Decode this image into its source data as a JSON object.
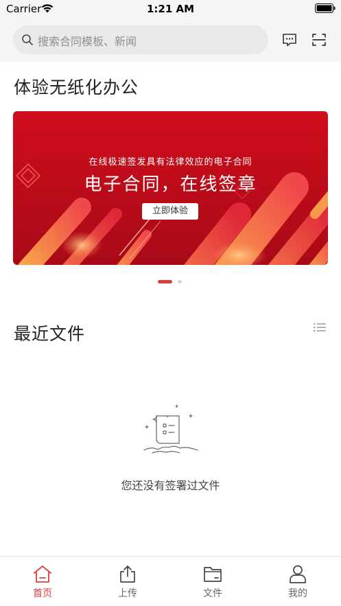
{
  "status_bar": {
    "carrier": "Carrier",
    "time": "1:21 AM"
  },
  "search": {
    "placeholder": "搜索合同模板、新闻"
  },
  "sections": {
    "experience_title": "体验无纸化办公",
    "recent_files_title": "最近文件"
  },
  "banner": {
    "subtitle": "在线极速签发具有法律效应的电子合同",
    "title": "电子合同，在线签章",
    "button_label": "立即体验"
  },
  "empty_state": {
    "message": "您还没有签署过文件"
  },
  "tabs": [
    {
      "label": "首页",
      "icon": "home-icon",
      "active": true
    },
    {
      "label": "上传",
      "icon": "upload-icon",
      "active": false
    },
    {
      "label": "文件",
      "icon": "folder-icon",
      "active": false
    },
    {
      "label": "我的",
      "icon": "user-icon",
      "active": false
    }
  ],
  "colors": {
    "accent": "#e23b3b",
    "banner_red": "#d0101e",
    "header_bg": "#f5f5f5",
    "search_bg": "#e9e9ea"
  }
}
